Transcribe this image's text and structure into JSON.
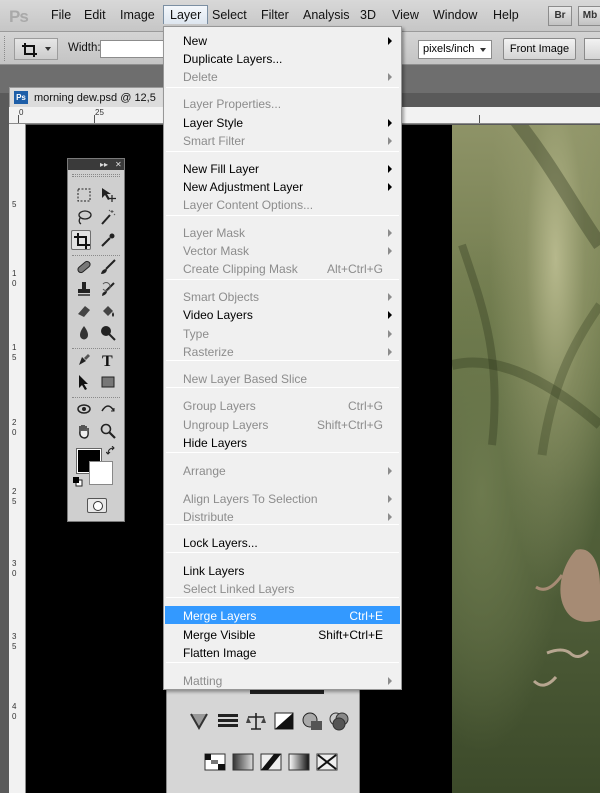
{
  "app": {
    "logo": "Ps"
  },
  "menubar": {
    "items": [
      {
        "label": "File"
      },
      {
        "label": "Edit"
      },
      {
        "label": "Image"
      },
      {
        "label": "Layer"
      },
      {
        "label": "Select"
      },
      {
        "label": "Filter"
      },
      {
        "label": "Analysis"
      },
      {
        "label": "3D"
      },
      {
        "label": "View"
      },
      {
        "label": "Window"
      },
      {
        "label": "Help"
      }
    ],
    "bridge_button": "Br",
    "minibridge_button": "Mb"
  },
  "options_bar": {
    "width_label": "Width:",
    "width_value": "",
    "units": "pixels/inch",
    "front_image_button": "Front Image"
  },
  "document": {
    "tab_title": "morning dew.psd @ 12,5",
    "ruler_top": [
      "0",
      "25"
    ],
    "ruler_left": [
      "5",
      "1",
      "0",
      "1",
      "5",
      "2",
      "0",
      "2",
      "5",
      "3",
      "0",
      "3",
      "5",
      "4",
      "0"
    ]
  },
  "tools_panel": {
    "header_collapse": "▸▸",
    "header_close": "✕"
  },
  "layer_menu": {
    "items": [
      {
        "label": "New",
        "shortcut": "",
        "submenu": true,
        "enabled": true
      },
      {
        "label": "Duplicate Layers...",
        "shortcut": "",
        "submenu": false,
        "enabled": true
      },
      {
        "label": "Delete",
        "shortcut": "",
        "submenu": true,
        "enabled": false
      },
      {
        "label": "Layer Properties...",
        "shortcut": "",
        "submenu": false,
        "enabled": false
      },
      {
        "label": "Layer Style",
        "shortcut": "",
        "submenu": true,
        "enabled": true
      },
      {
        "label": "Smart Filter",
        "shortcut": "",
        "submenu": true,
        "enabled": false
      },
      {
        "label": "New Fill Layer",
        "shortcut": "",
        "submenu": true,
        "enabled": true
      },
      {
        "label": "New Adjustment Layer",
        "shortcut": "",
        "submenu": true,
        "enabled": true
      },
      {
        "label": "Layer Content Options...",
        "shortcut": "",
        "submenu": false,
        "enabled": false
      },
      {
        "label": "Layer Mask",
        "shortcut": "",
        "submenu": true,
        "enabled": false
      },
      {
        "label": "Vector Mask",
        "shortcut": "",
        "submenu": true,
        "enabled": false
      },
      {
        "label": "Create Clipping Mask",
        "shortcut": "Alt+Ctrl+G",
        "submenu": false,
        "enabled": false
      },
      {
        "label": "Smart Objects",
        "shortcut": "",
        "submenu": true,
        "enabled": false
      },
      {
        "label": "Video Layers",
        "shortcut": "",
        "submenu": true,
        "enabled": true
      },
      {
        "label": "Type",
        "shortcut": "",
        "submenu": true,
        "enabled": false
      },
      {
        "label": "Rasterize",
        "shortcut": "",
        "submenu": true,
        "enabled": false
      },
      {
        "label": "New Layer Based Slice",
        "shortcut": "",
        "submenu": false,
        "enabled": false
      },
      {
        "label": "Group Layers",
        "shortcut": "Ctrl+G",
        "submenu": false,
        "enabled": false
      },
      {
        "label": "Ungroup Layers",
        "shortcut": "Shift+Ctrl+G",
        "submenu": false,
        "enabled": false
      },
      {
        "label": "Hide Layers",
        "shortcut": "",
        "submenu": false,
        "enabled": true
      },
      {
        "label": "Arrange",
        "shortcut": "",
        "submenu": true,
        "enabled": false
      },
      {
        "label": "Align Layers To Selection",
        "shortcut": "",
        "submenu": true,
        "enabled": false
      },
      {
        "label": "Distribute",
        "shortcut": "",
        "submenu": true,
        "enabled": false
      },
      {
        "label": "Lock Layers...",
        "shortcut": "",
        "submenu": false,
        "enabled": true
      },
      {
        "label": "Link Layers",
        "shortcut": "",
        "submenu": false,
        "enabled": true
      },
      {
        "label": "Select Linked Layers",
        "shortcut": "",
        "submenu": false,
        "enabled": false
      },
      {
        "label": "Merge Layers",
        "shortcut": "Ctrl+E",
        "submenu": false,
        "enabled": true,
        "highlighted": true
      },
      {
        "label": "Merge Visible",
        "shortcut": "Shift+Ctrl+E",
        "submenu": false,
        "enabled": true
      },
      {
        "label": "Flatten Image",
        "shortcut": "",
        "submenu": false,
        "enabled": true
      },
      {
        "label": "Matting",
        "shortcut": "",
        "submenu": true,
        "enabled": false
      }
    ]
  },
  "colors": {
    "highlight": "#3399ff",
    "disabled_text": "#8c8c8c",
    "menu_bg": "#f0f0f0"
  }
}
